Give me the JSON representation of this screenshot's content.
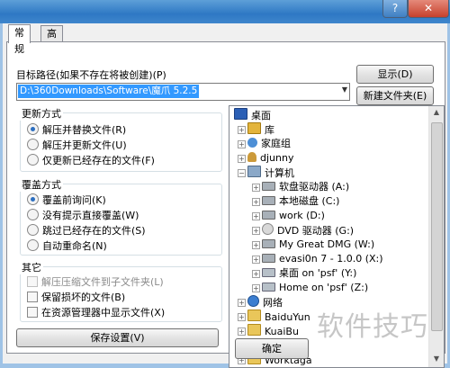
{
  "tabs": [
    {
      "label": "常规"
    },
    {
      "label": "高级"
    }
  ],
  "target_path": {
    "label": "目标路径(如果不存在将被创建)(P)",
    "value": "D:\\360Downloads\\Software\\魔爪 5.2.5"
  },
  "buttons": {
    "show": "显示(D)",
    "new_folder": "新建文件夹(E)",
    "save_settings": "保存设置(V)",
    "ok": "确定",
    "close": "✕",
    "help": "?"
  },
  "update_mode": {
    "title": "更新方式",
    "options": [
      {
        "label": "解压并替换文件(R)",
        "checked": true
      },
      {
        "label": "解压并更新文件(U)",
        "checked": false
      },
      {
        "label": "仅更新已经存在的文件(F)",
        "checked": false
      }
    ]
  },
  "overwrite_mode": {
    "title": "覆盖方式",
    "options": [
      {
        "label": "覆盖前询问(K)",
        "checked": true
      },
      {
        "label": "没有提示直接覆盖(W)",
        "checked": false
      },
      {
        "label": "跳过已经存在的文件(S)",
        "checked": false
      },
      {
        "label": "自动重命名(N)",
        "checked": false
      }
    ]
  },
  "misc": {
    "title": "其它",
    "options": [
      {
        "label": "解压压缩文件到子文件夹(L)",
        "checked": false,
        "disabled": true
      },
      {
        "label": "保留损坏的文件(B)",
        "checked": false,
        "disabled": false
      },
      {
        "label": "在资源管理器中显示文件(X)",
        "checked": false,
        "disabled": false
      }
    ]
  },
  "tree": [
    {
      "label": "桌面",
      "icon": "desktop-icon"
    },
    {
      "label": "库",
      "icon": "library-icon"
    },
    {
      "label": "家庭组",
      "icon": "homegroup-icon"
    },
    {
      "label": "djunny",
      "icon": "user-folder-icon"
    },
    {
      "label": "计算机",
      "icon": "computer-icon"
    },
    {
      "label": "软盘驱动器 (A:)",
      "icon": "floppy-drive-icon"
    },
    {
      "label": "本地磁盘 (C:)",
      "icon": "local-disk-icon"
    },
    {
      "label": "work (D:)",
      "icon": "local-disk-icon"
    },
    {
      "label": "DVD 驱动器 (G:)",
      "icon": "dvd-drive-icon"
    },
    {
      "label": "My Great DMG (W:)",
      "icon": "virtual-drive-icon"
    },
    {
      "label": "evasi0n 7 - 1.0.0 (X:)",
      "icon": "virtual-drive-icon"
    },
    {
      "label": "桌面 on 'psf' (Y:)",
      "icon": "network-drive-icon"
    },
    {
      "label": "Home on 'psf' (Z:)",
      "icon": "network-drive-icon"
    },
    {
      "label": "网络",
      "icon": "network-icon"
    },
    {
      "label": "BaiduYun",
      "icon": "folder-icon"
    },
    {
      "label": "KuaiBu",
      "icon": "folder-icon"
    },
    {
      "label": "mozhua",
      "icon": "folder-icon"
    },
    {
      "label": "Worktaga",
      "icon": "folder-icon"
    }
  ],
  "watermark": "软件技巧"
}
